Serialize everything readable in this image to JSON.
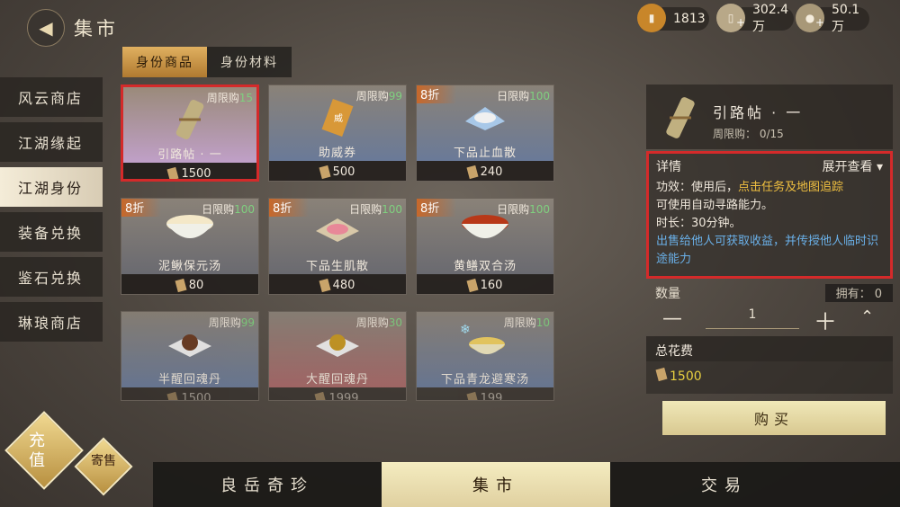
{
  "header": {
    "title": "集市",
    "back_icon": "back-arrow-icon"
  },
  "currencies": [
    {
      "icon": "token-icon",
      "value": "1813",
      "color": "#c8862a"
    },
    {
      "icon": "scroll-currency-icon",
      "value": "302.4万",
      "color": "#b8a888"
    },
    {
      "icon": "coin-icon",
      "value": "50.1万",
      "color": "#a89878"
    }
  ],
  "tabs": [
    {
      "label": "身份商品",
      "active": true
    },
    {
      "label": "身份材料",
      "active": false
    }
  ],
  "sidebar": [
    {
      "label": "风云商店"
    },
    {
      "label": "江湖缘起"
    },
    {
      "label": "江湖身份",
      "active": true
    },
    {
      "label": "装备兑换"
    },
    {
      "label": "鉴石兑换"
    },
    {
      "label": "琳琅商店"
    }
  ],
  "items": [
    {
      "name": "引路帖 · 一",
      "price": "1500",
      "limit_label": "周限购",
      "limit": "15",
      "discount": "",
      "selected": true,
      "icon": "scroll-icon"
    },
    {
      "name": "助威券",
      "price": "500",
      "limit_label": "周限购",
      "limit": "99",
      "discount": "",
      "icon": "ticket-icon"
    },
    {
      "name": "下品止血散",
      "price": "240",
      "limit_label": "日限购",
      "limit": "100",
      "discount": "8折",
      "icon": "powder-icon"
    },
    {
      "name": "泥鳅保元汤",
      "price": "80",
      "limit_label": "日限购",
      "limit": "100",
      "discount": "8折",
      "icon": "soup-bowl-icon"
    },
    {
      "name": "下品生肌散",
      "price": "480",
      "limit_label": "日限购",
      "limit": "100",
      "discount": "8折",
      "icon": "powder-packet-icon"
    },
    {
      "name": "黄鳝双合汤",
      "price": "160",
      "limit_label": "日限购",
      "limit": "100",
      "discount": "8折",
      "icon": "red-soup-icon"
    },
    {
      "name": "半醒回魂丹",
      "price": "1500",
      "limit_label": "周限购",
      "limit": "99",
      "discount": "",
      "icon": "pill-icon"
    },
    {
      "name": "大醒回魂丹",
      "price": "1999",
      "limit_label": "周限购",
      "limit": "30",
      "discount": "",
      "icon": "gold-pill-icon"
    },
    {
      "name": "下品青龙避寒汤",
      "price": "199",
      "limit_label": "周限购",
      "limit": "10",
      "discount": "",
      "icon": "cold-soup-icon"
    }
  ],
  "detail": {
    "name": "引路帖 · 一",
    "limit": "周限购： 0/15",
    "section_label": "详情",
    "expand_label": "展开查看",
    "effect_prefix": "功效：使用后，",
    "effect_highlight": "点击任务及地图追踪",
    "effect_suffix": "可使用自动寻路能力。",
    "duration": "时长：30分钟。",
    "sell_note": "出售给他人可获取收益，并传授他人临时识途能力",
    "qty_label": "数量",
    "owned_label": "拥有：",
    "owned": "0",
    "qty": "1",
    "total_label": "总花费",
    "total": "1500",
    "buy_label": "购买"
  },
  "bottom_tabs": [
    {
      "label": "良岳奇珍"
    },
    {
      "label": "集市",
      "active": true
    },
    {
      "label": "交易"
    }
  ],
  "corner": {
    "charge_label": "充值",
    "consign_label": "寄售"
  }
}
